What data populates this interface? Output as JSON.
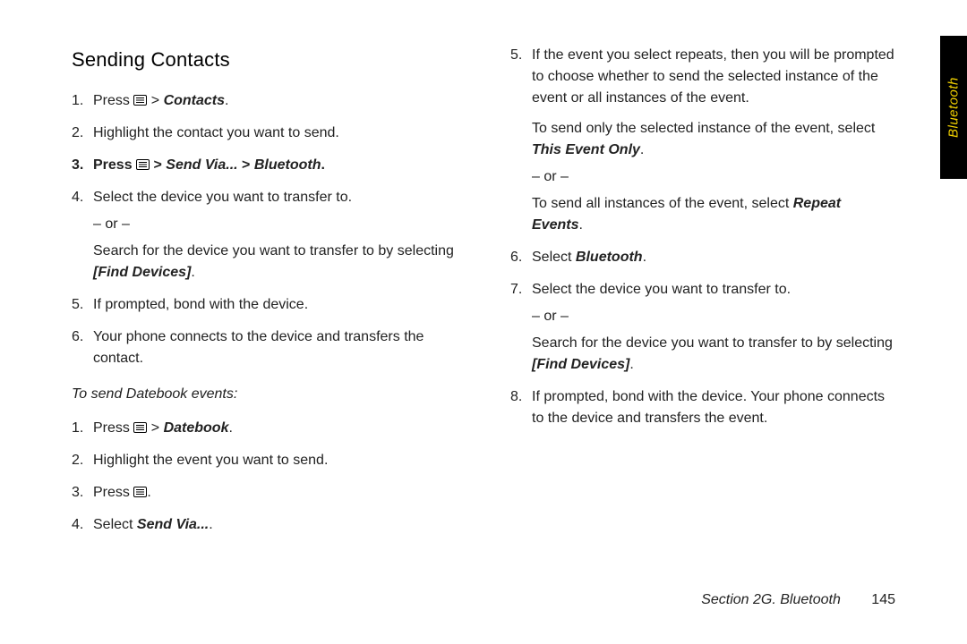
{
  "heading": "Sending Contacts",
  "list_a": {
    "i1_pre": "Press ",
    "i1_icon": "menu-icon",
    "i1_post_gt": " > ",
    "i1_contacts": "Contacts",
    "i1_dot": ".",
    "i2": "Highlight the contact you want to send.",
    "i3_pre": "Press ",
    "i3_post": " > ",
    "i3_send": "Send Via...",
    "i3_gt2": " > ",
    "i3_bt": "Bluetooth",
    "i3_dot": ".",
    "i4_a": "Select the device you want to transfer to.",
    "i4_or": "– or –",
    "i4_b_pre": "Search for the device you want to transfer to by selecting ",
    "i4_b_find": "[Find Devices]",
    "i4_b_dot": ".",
    "i5": "If prompted, bond with the device.",
    "i6": "Your phone connects to the device and transfers the contact."
  },
  "subhead": "To send Datebook events:",
  "list_b": {
    "i1_pre": "Press ",
    "i1_post": " > ",
    "i1_db": "Datebook",
    "i1_dot": ".",
    "i2": "Highlight the event you want to send.",
    "i3_pre": "Press ",
    "i3_dot": ".",
    "i4_pre": "Select ",
    "i4_send": "Send Via...",
    "i4_dot": "."
  },
  "list_c": {
    "i5": "If the event you select repeats, then you will be prompted to choose whether to send the selected instance of the event or all instances of the event.",
    "i5_p2_pre": "To send only the selected instance of the event, select ",
    "i5_p2_this": "This Event Only",
    "i5_p2_dot": ".",
    "i5_or": "– or –",
    "i5_p3_pre": "To send all instances of the event, select ",
    "i5_p3_rep": "Repeat Events",
    "i5_p3_dot": ".",
    "i6_pre": "Select ",
    "i6_bt": "Bluetooth",
    "i6_dot": ".",
    "i7_a": "Select the device you want to transfer to.",
    "i7_or": "– or –",
    "i7_b_pre": "Search for the device you want to transfer to by selecting ",
    "i7_b_find": "[Find Devices]",
    "i7_b_dot": ".",
    "i8": "If prompted, bond with the device. Your phone connects to the device and transfers the event."
  },
  "footer": {
    "section": "Section 2G. Bluetooth",
    "page": "145"
  },
  "tab": "Bluetooth"
}
